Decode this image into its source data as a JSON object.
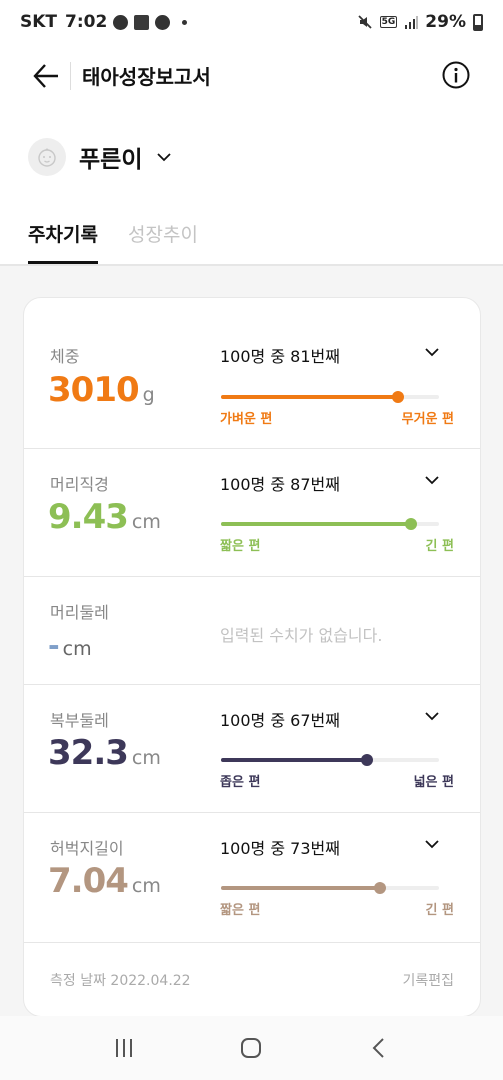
{
  "status_bar": {
    "carrier": "SKT",
    "time": "7:02",
    "network": "5G",
    "battery": "29%"
  },
  "header": {
    "title": "태아성장보고서"
  },
  "profile": {
    "name": "푸른이"
  },
  "tabs": [
    {
      "label": "주차기록",
      "active": true
    },
    {
      "label": "성장추이",
      "active": false
    }
  ],
  "metrics": [
    {
      "label": "체중",
      "value": "3010",
      "unit": "g",
      "rank": "100명 중 81번째",
      "percentile": 0.81,
      "left_label": "가벼운 편",
      "right_label": "무거운 편",
      "color": "#f07a14"
    },
    {
      "label": "머리직경",
      "value": "9.43",
      "unit": "cm",
      "rank": "100명 중 87번째",
      "percentile": 0.87,
      "left_label": "짧은 편",
      "right_label": "긴 편",
      "color": "#8dbf55"
    },
    {
      "label": "머리둘레",
      "value": "-",
      "unit": "cm",
      "empty_text": "입력된 수치가 없습니다.",
      "color": "#7f9fc9"
    },
    {
      "label": "복부둘레",
      "value": "32.3",
      "unit": "cm",
      "rank": "100명 중 67번째",
      "percentile": 0.67,
      "left_label": "좁은 편",
      "right_label": "넓은 편",
      "color": "#3d3859"
    },
    {
      "label": "허벅지길이",
      "value": "7.04",
      "unit": "cm",
      "rank": "100명 중 73번째",
      "percentile": 0.73,
      "left_label": "짧은 편",
      "right_label": "긴 편",
      "color": "#b39680"
    }
  ],
  "footer": {
    "date": "측정 날짜 2022.04.22",
    "edit": "기록편집"
  }
}
